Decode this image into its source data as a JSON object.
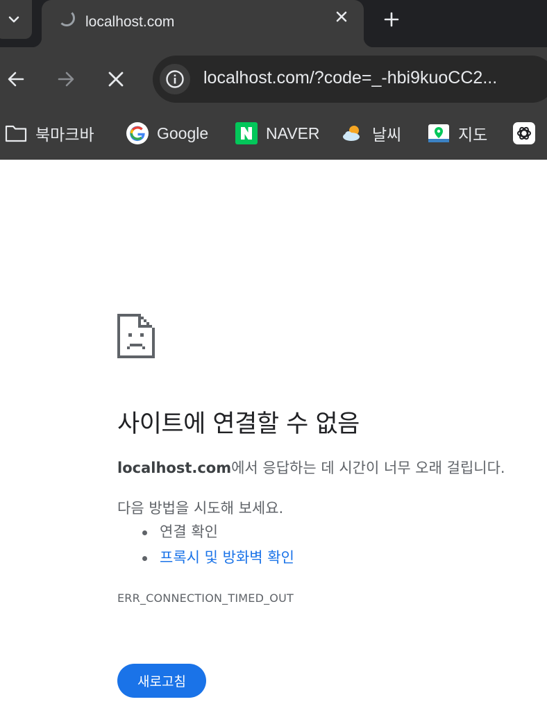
{
  "tab": {
    "title": "localhost.com",
    "loading": true
  },
  "toolbar": {
    "url": "localhost.com/?code=_-hbi9kuoCC2..."
  },
  "bookmarks": [
    {
      "label": "북마크바",
      "icon": "folder-icon"
    },
    {
      "label": "Google",
      "icon": "google-icon"
    },
    {
      "label": "NAVER",
      "icon": "naver-icon"
    },
    {
      "label": "날씨",
      "icon": "weather-icon"
    },
    {
      "label": "지도",
      "icon": "map-icon"
    },
    {
      "label": "",
      "icon": "chatgpt-icon"
    }
  ],
  "error": {
    "icon": "sad-page-icon",
    "title": "사이트에 연결할 수 없음",
    "host": "localhost.com",
    "description_suffix": "에서 응답하는 데 시간이 너무 오래 걸립니다.",
    "try_intro": "다음 방법을 시도해 보세요.",
    "suggestions": [
      {
        "text": "연결 확인",
        "link": false
      },
      {
        "text": "프록시 및 방화벽 확인",
        "link": true
      }
    ],
    "code": "ERR_CONNECTION_TIMED_OUT",
    "reload_label": "새로고침"
  },
  "colors": {
    "chrome_dark": "#202124",
    "chrome_toolbar": "#3c3c3c",
    "omnibox": "#282828",
    "link_blue": "#1a73e8",
    "reload_button": "#1a73e8",
    "naver_green": "#03c75a"
  }
}
